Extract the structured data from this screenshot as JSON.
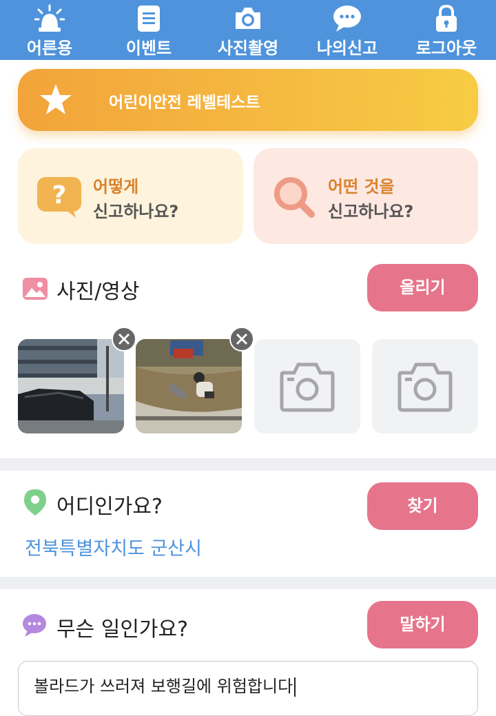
{
  "nav": {
    "items": [
      {
        "label": "어른용",
        "icon": "siren-icon"
      },
      {
        "label": "이벤트",
        "icon": "document-icon"
      },
      {
        "label": "사진촬영",
        "icon": "camera-icon"
      },
      {
        "label": "나의신고",
        "icon": "chat-bubble-icon"
      },
      {
        "label": "로그아웃",
        "icon": "lock-icon"
      }
    ]
  },
  "banner": {
    "text": "어린이안전 레벨테스트",
    "icon": "star-icon"
  },
  "cards": [
    {
      "line1": "어떻게",
      "line2": "신고하나요?",
      "icon": "question-bubble-icon"
    },
    {
      "line1": "어떤 것을",
      "line2": "신고하나요?",
      "icon": "magnifier-icon"
    }
  ],
  "photos": {
    "title": "사진/영상",
    "upload_label": "올리기",
    "slots": [
      {
        "state": "filled",
        "alt": "street-parking-photo"
      },
      {
        "state": "filled",
        "alt": "fallen-bollard-photo"
      },
      {
        "state": "empty"
      },
      {
        "state": "empty"
      }
    ]
  },
  "location": {
    "title": "어디인가요?",
    "find_label": "찾기",
    "address": "전북특별자치도 군산시"
  },
  "issue": {
    "title": "무슨 일인가요?",
    "speak_label": "말하기",
    "text": "볼라드가 쓰러져 보행길에 위험합니다"
  },
  "colors": {
    "nav_bg": "#4e93dc",
    "accent_pink": "#e6758b",
    "banner": "#f5b940",
    "link_blue": "#4e93dc"
  }
}
